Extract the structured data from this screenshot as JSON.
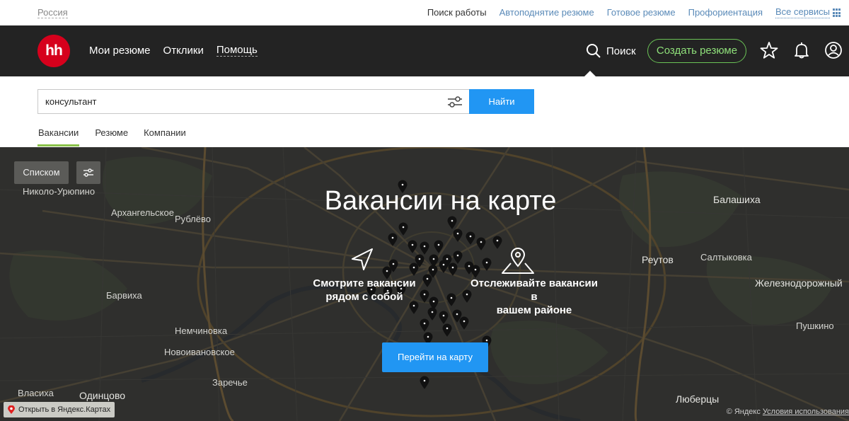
{
  "topbar": {
    "region": "Россия",
    "links": [
      "Поиск работы",
      "Автоподнятие резюме",
      "Готовое резюме",
      "Профориентация",
      "Все сервисы"
    ]
  },
  "header": {
    "logo": "hh",
    "nav": [
      "Мои резюме",
      "Отклики",
      "Помощь"
    ],
    "search_label": "Поиск",
    "create_resume": "Создать резюме",
    "icons": [
      "star-icon",
      "bell-icon",
      "user-icon"
    ]
  },
  "search": {
    "value": "консультант",
    "button": "Найти",
    "tabs": [
      "Вакансии",
      "Резюме",
      "Компании"
    ]
  },
  "map": {
    "list_button": "Списком",
    "title": "Вакансии на карте",
    "feature_nearby": "Смотрите вакансии\nрядом с собой",
    "feature_district": "Отслеживайте вакансии в\nвашем районе",
    "goto_button": "Перейти на карту",
    "open_yandex": "Открыть в Яндекс.Картах",
    "copyright": "© Яндекс",
    "terms": "Условия использования",
    "labels": {
      "balashikha": "Балашиха",
      "reutov": "Реутов",
      "zheleznodorozhny": "Железнодорожный",
      "odintsovo": "Одинцово",
      "vlasikha": "Власиха",
      "lyubertsy": "Люберцы",
      "arkhangelskoe": "Архангельское",
      "saltykovka": "Салтыковка",
      "rublevo": "Рублёво",
      "nikolo_uryupino": "Николо-Урюпино",
      "nemchinovka": "Немчиновка",
      "novoivanovskoe": "Новоивановское",
      "zarechye": "Заречье",
      "barvikha": "Барвиха",
      "pushkino": "Пушкино"
    },
    "accent": "#2196f3"
  }
}
